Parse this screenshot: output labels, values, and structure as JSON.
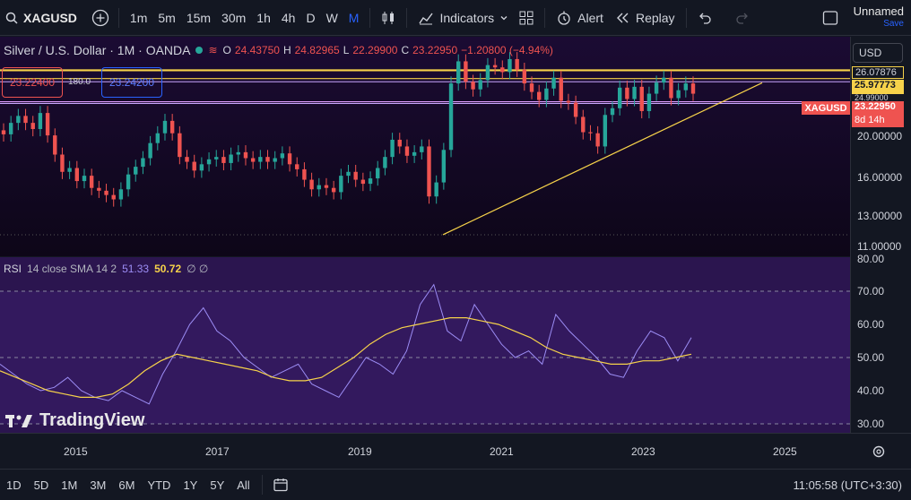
{
  "toolbar": {
    "symbol": "XAGUSD",
    "timeframes": [
      "1m",
      "5m",
      "15m",
      "30m",
      "1h",
      "4h",
      "D",
      "W",
      "M"
    ],
    "active_timeframe": "M",
    "indicators_label": "Indicators",
    "alert_label": "Alert",
    "replay_label": "Replay",
    "layout_name": "Unnamed",
    "save_label": "Save"
  },
  "legend": {
    "title": "Silver / U.S. Dollar · 1M · OANDA",
    "o_key": "O",
    "o_val": "24.43750",
    "h_key": "H",
    "h_val": "24.82965",
    "l_key": "L",
    "l_val": "22.29900",
    "c_key": "C",
    "c_val": "23.22950",
    "change": "−1.20800 (−4.94%)"
  },
  "orders": {
    "sell": "23.22400",
    "buy": "23.24200",
    "spread": "180.0"
  },
  "currency": "USD",
  "price_axis": {
    "ticks": [
      "20.00000",
      "16.00000",
      "13.00000",
      "11.00000"
    ],
    "rsi_ticks": [
      "80.00",
      "70.00",
      "60.00",
      "50.00",
      "40.00",
      "30.00"
    ],
    "level_1": "26.07876",
    "level_2": "25.97773",
    "level_3": "24.99000",
    "current_price": "23.22950",
    "countdown": "8d 14h",
    "symbol_tag": "XAGUSD"
  },
  "rsi": {
    "name": "RSI",
    "params": "14 close SMA 14 2",
    "rsi_val": "51.33",
    "ma_val": "50.72",
    "extra": "∅ ∅"
  },
  "time_axis": [
    "2015",
    "2017",
    "2019",
    "2021",
    "2023",
    "2025"
  ],
  "bottombar": {
    "ranges": [
      "1D",
      "5D",
      "1M",
      "3M",
      "6M",
      "YTD",
      "1Y",
      "5Y",
      "All"
    ],
    "clock": "11:05:58 (UTC+3:30)"
  },
  "brand": "TradingView",
  "colors": {
    "up": "#26a69a",
    "down": "#ef5350",
    "trend": "#f6d24a",
    "rsi": "#9c8df5",
    "accent": "#2962ff"
  },
  "chart_data": {
    "type": "candlestick",
    "title": "Silver / U.S. Dollar · 1M · OANDA",
    "x_range": [
      "2014",
      "2025"
    ],
    "ylim": [
      11,
      27
    ],
    "candles_close": [
      19.0,
      20.1,
      20.8,
      20.1,
      19.5,
      21.1,
      18.9,
      17.2,
      15.8,
      16.1,
      15.1,
      15.5,
      14.6,
      14.4,
      14.1,
      13.8,
      14.5,
      15.6,
      16.2,
      16.9,
      18.2,
      19.1,
      20.3,
      19.1,
      17.0,
      16.6,
      15.9,
      16.4,
      16.8,
      17.0,
      16.5,
      17.2,
      17.4,
      16.9,
      16.6,
      17.0,
      16.6,
      16.9,
      17.3,
      16.4,
      16.0,
      15.2,
      14.5,
      14.8,
      14.6,
      14.3,
      15.5,
      15.8,
      15.2,
      14.9,
      15.3,
      16.1,
      17.0,
      18.5,
      17.9,
      17.1,
      17.4,
      17.9,
      14.0,
      15.0,
      17.6,
      24.4,
      27.2,
      24.6,
      23.7,
      24.8,
      26.7,
      26.4,
      25.8,
      27.5,
      26.1,
      24.4,
      23.4,
      22.5,
      23.8,
      25.1,
      22.4,
      22.2,
      20.7,
      19.2,
      19.1,
      17.9,
      20.9,
      21.6,
      23.9,
      22.6,
      24.0,
      21.3,
      23.2,
      24.5,
      25.1,
      22.7,
      23.6,
      24.4,
      23.2
    ],
    "rsi": [
      48,
      45,
      42,
      40,
      41,
      44,
      40,
      38,
      37,
      40,
      38,
      36,
      45,
      52,
      60,
      65,
      58,
      55,
      50,
      47,
      44,
      46,
      48,
      42,
      40,
      38,
      44,
      50,
      48,
      45,
      52,
      66,
      72,
      58,
      55,
      66,
      60,
      54,
      50,
      52,
      48,
      63,
      58,
      54,
      50,
      45,
      44,
      52,
      58,
      56,
      49,
      56
    ],
    "rsi_ma": [
      46,
      44,
      42,
      40,
      39,
      38,
      38,
      39,
      42,
      46,
      49,
      51,
      50,
      49,
      48,
      47,
      46,
      44,
      43,
      43,
      44,
      47,
      50,
      54,
      57,
      59,
      60,
      61,
      62,
      62,
      61,
      60,
      58,
      56,
      53,
      51,
      50,
      49,
      48,
      48,
      49,
      49,
      50,
      51
    ],
    "trendline": {
      "from": [
        "2019-08",
        11.6
      ],
      "to": [
        "2024-06",
        24.8
      ]
    },
    "horizontal_levels": [
      26.07876,
      25.97773,
      24.99,
      22.3
    ]
  }
}
